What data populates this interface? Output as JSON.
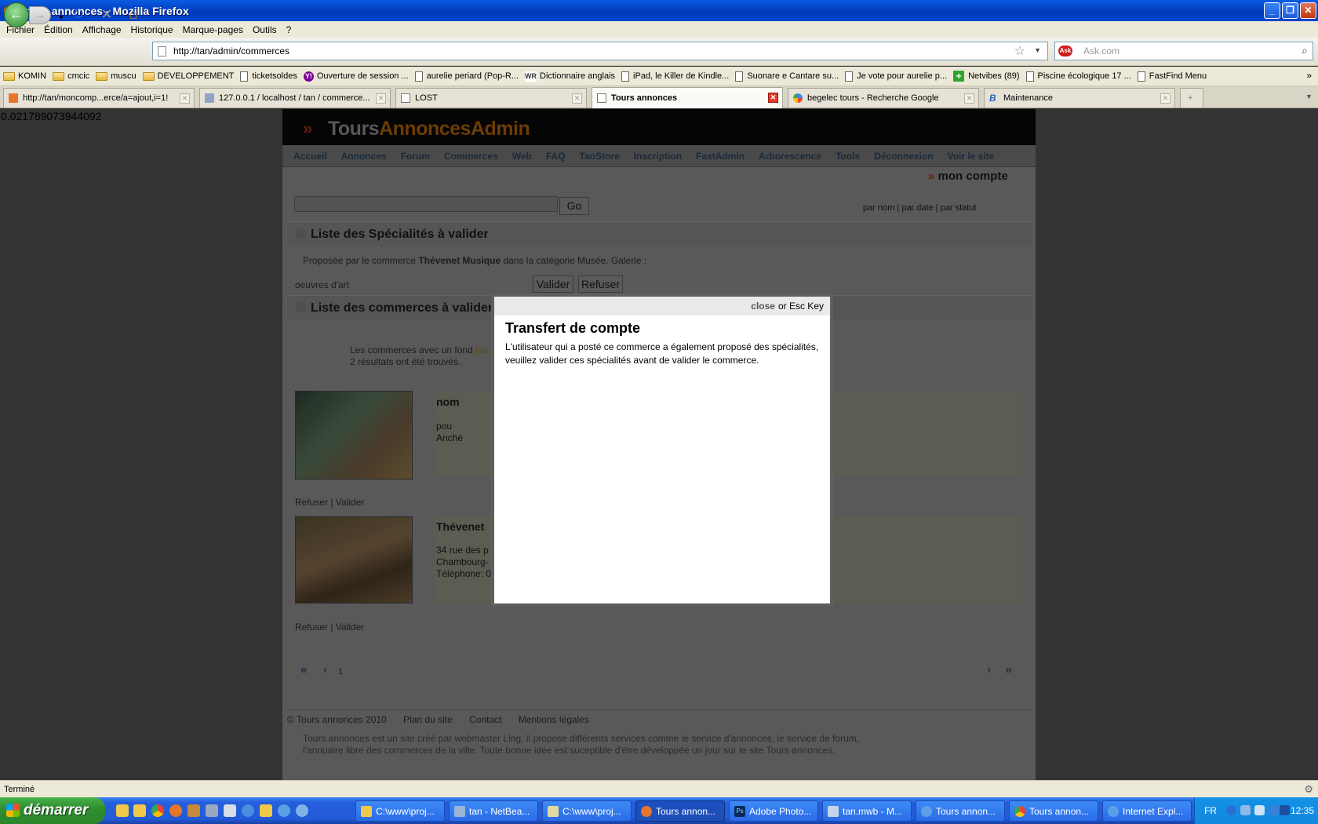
{
  "window": {
    "title": "Tours annonces - Mozilla Firefox"
  },
  "menu": [
    "Fichier",
    "Édition",
    "Affichage",
    "Historique",
    "Marque-pages",
    "Outils",
    "?"
  ],
  "toolbar": {
    "url": "http://tan/admin/commerces",
    "search_placeholder": "Ask.com"
  },
  "bookmarks": [
    {
      "label": "KOMIN",
      "icon": "folder-icon"
    },
    {
      "label": "cmcic",
      "icon": "folder-icon"
    },
    {
      "label": "muscu",
      "icon": "folder-icon"
    },
    {
      "label": "DEVELOPPEMENT",
      "icon": "folder-icon"
    },
    {
      "label": "ticketsoldes",
      "icon": "page-icon"
    },
    {
      "label": "Ouverture de session ...",
      "icon": "yahoo-icon"
    },
    {
      "label": "aurelie periard (Pop-R...",
      "icon": "page-icon"
    },
    {
      "label": "Dictionnaire anglais",
      "icon": "wordreference-icon"
    },
    {
      "label": "iPad, le Killer de Kindle...",
      "icon": "page-icon"
    },
    {
      "label": "Suonare e Cantare su...",
      "icon": "page-icon"
    },
    {
      "label": "Je vote pour aurelie p...",
      "icon": "page-icon"
    },
    {
      "label": "Netvibes (89)",
      "icon": "netvibes-icon"
    },
    {
      "label": "Piscine écologique 17 ...",
      "icon": "page-icon"
    },
    {
      "label": "FastFind Menu",
      "icon": "page-icon"
    }
  ],
  "tabs": [
    {
      "label": "http://tan/moncomp...erce/a=ajout,i=1!",
      "active": false
    },
    {
      "label": "127.0.0.1 / localhost / tan / commerce...",
      "active": false
    },
    {
      "label": "LOST",
      "active": false
    },
    {
      "label": "Tours annonces",
      "active": true
    },
    {
      "label": "begelec tours - Recherche Google",
      "active": false
    },
    {
      "label": "Maintenance",
      "active": false
    }
  ],
  "page": {
    "counter": "0.021789073944092",
    "logo_part1": "Tours",
    "logo_part2": "AnnoncesAdmin",
    "nav": [
      "Accueil",
      "Annonces",
      "Forum",
      "Commerces",
      "Web",
      "FAQ",
      "TaoStore",
      "Inscription",
      "FastAdmin",
      "Arborescence",
      "Tools",
      "Déconnexion",
      "Voir le site"
    ],
    "account": "mon compte",
    "go": "Go",
    "sort_links": "par nom | par date | par statut",
    "section1_title": "Liste des Spécialités à valider",
    "spec_desc_prefix": "Proposée par le commerce ",
    "spec_desc_shop": "Thévenet Musique",
    "spec_desc_suffix": " dans la catégorie Musée, Galerie :",
    "spec_item": "oeuvres d'art",
    "validate": "Valider",
    "refuse": "Refuser",
    "section2_title": "Liste des commerces à valider",
    "note_line1": "Les commerces avec un fond ",
    "note_highlight": "jau",
    "note_line2": "2 résultats ont été trouvés.",
    "card1": {
      "title": "nom",
      "line1": "pou",
      "line2": "Anché"
    },
    "card2": {
      "title": "Thévenet",
      "line1": "34 rue des p",
      "line2": "Chambourg-",
      "line3": "Téléphone: 0"
    },
    "refuse_validate": "Refuser | Valider",
    "pager_first": "«",
    "pager_prev": "‹",
    "pager_page": "1",
    "pager_next": "›",
    "pager_last": "»",
    "footer_copy": "© Tours annonces 2010",
    "footer_plan": "Plan du site",
    "footer_contact": "Contact",
    "footer_legal": "Mentions légales",
    "footer_note1": "Tours annonces est un site créé par webmaster Ling, il propose différents services comme le service d'annonces, le service de forum,",
    "footer_note2": "l'annuaire libre des commerces de la ville. Toute bonne idée est suceptible d'être développée un jour sur le site Tours annonces."
  },
  "modal": {
    "close": "close",
    "or_esc": "or Esc Key",
    "title": "Transfert de compte",
    "body": "L'utilisateur qui a posté ce commerce a également proposé des spécialités, veuillez valider ces spécialités avant de valider le commerce."
  },
  "status": "Terminé",
  "taskbar": {
    "start": "démarrer",
    "tasks": [
      {
        "label": "C:\\www\\proj...",
        "icon": "folder-icon"
      },
      {
        "label": "tan - NetBea...",
        "icon": "netbeans-icon"
      },
      {
        "label": "C:\\www\\proj...",
        "icon": "notepad-icon"
      },
      {
        "label": "Tours annon...",
        "icon": "firefox-icon",
        "active": true
      },
      {
        "label": "Adobe Photo...",
        "icon": "photoshop-icon"
      },
      {
        "label": "tan.mwb - M...",
        "icon": "workbench-icon"
      },
      {
        "label": "Tours annon...",
        "icon": "ie-icon"
      },
      {
        "label": "Tours annon...",
        "icon": "chrome-icon"
      },
      {
        "label": "Internet Expl...",
        "icon": "ie-icon"
      }
    ],
    "lang": "FR",
    "clock": "12:35"
  },
  "colors": {
    "titlebar": "#0a5be0",
    "taskbar": "#245edb",
    "start": "#2e8f2e",
    "overlay": "#333333"
  }
}
